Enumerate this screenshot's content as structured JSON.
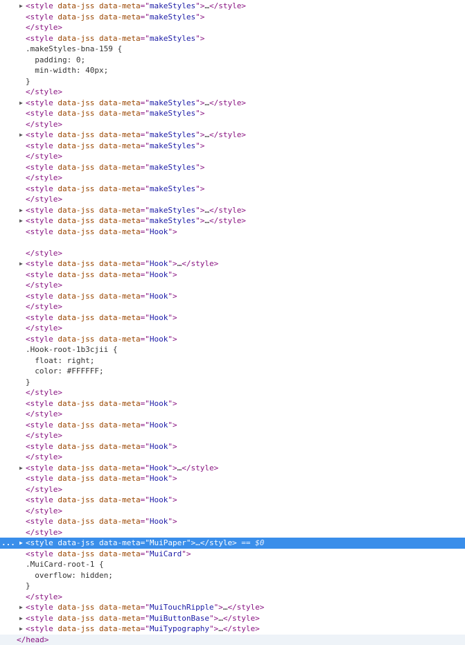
{
  "rows": [
    {
      "type": "collapsed",
      "meta": "makeStyles"
    },
    {
      "type": "open",
      "meta": "makeStyles"
    },
    {
      "type": "close"
    },
    {
      "type": "open",
      "meta": "makeStyles"
    },
    {
      "type": "css",
      "text": ".makeStyles-bna-159 {"
    },
    {
      "type": "css",
      "text": "  padding: 0;"
    },
    {
      "type": "css",
      "text": "  min-width: 40px;"
    },
    {
      "type": "css",
      "text": "}"
    },
    {
      "type": "close"
    },
    {
      "type": "collapsed",
      "meta": "makeStyles"
    },
    {
      "type": "open",
      "meta": "makeStyles"
    },
    {
      "type": "close"
    },
    {
      "type": "collapsed",
      "meta": "makeStyles"
    },
    {
      "type": "open",
      "meta": "makeStyles"
    },
    {
      "type": "close"
    },
    {
      "type": "open",
      "meta": "makeStyles"
    },
    {
      "type": "close"
    },
    {
      "type": "open",
      "meta": "makeStyles"
    },
    {
      "type": "close"
    },
    {
      "type": "collapsed",
      "meta": "makeStyles"
    },
    {
      "type": "collapsed",
      "meta": "makeStyles"
    },
    {
      "type": "open",
      "meta": "Hook"
    },
    {
      "type": "blank"
    },
    {
      "type": "close"
    },
    {
      "type": "collapsed",
      "meta": "Hook"
    },
    {
      "type": "open",
      "meta": "Hook"
    },
    {
      "type": "close"
    },
    {
      "type": "open",
      "meta": "Hook"
    },
    {
      "type": "close"
    },
    {
      "type": "open",
      "meta": "Hook"
    },
    {
      "type": "close"
    },
    {
      "type": "open",
      "meta": "Hook"
    },
    {
      "type": "css",
      "text": ".Hook-root-1b3cjii {"
    },
    {
      "type": "css",
      "text": "  float: right;"
    },
    {
      "type": "css",
      "text": "  color: #FFFFFF;"
    },
    {
      "type": "css",
      "text": "}"
    },
    {
      "type": "close"
    },
    {
      "type": "open",
      "meta": "Hook"
    },
    {
      "type": "close"
    },
    {
      "type": "open",
      "meta": "Hook"
    },
    {
      "type": "close"
    },
    {
      "type": "open",
      "meta": "Hook"
    },
    {
      "type": "close"
    },
    {
      "type": "collapsed",
      "meta": "Hook"
    },
    {
      "type": "open",
      "meta": "Hook"
    },
    {
      "type": "close"
    },
    {
      "type": "open",
      "meta": "Hook"
    },
    {
      "type": "close"
    },
    {
      "type": "open",
      "meta": "Hook"
    },
    {
      "type": "close"
    },
    {
      "type": "collapsed",
      "meta": "MuiPaper",
      "selected": true,
      "suffix": " == $0",
      "dots": "..."
    },
    {
      "type": "open",
      "meta": "MuiCard"
    },
    {
      "type": "css",
      "text": ".MuiCard-root-1 {"
    },
    {
      "type": "css",
      "text": "  overflow: hidden;"
    },
    {
      "type": "css",
      "text": "}"
    },
    {
      "type": "close"
    },
    {
      "type": "collapsed",
      "meta": "MuiTouchRipple"
    },
    {
      "type": "collapsed",
      "meta": "MuiButtonBase"
    },
    {
      "type": "collapsed",
      "meta": "MuiTypography"
    },
    {
      "type": "headclose",
      "text": "</head>"
    }
  ],
  "strings": {
    "open_tag": "<style",
    "attr1": " data-jss",
    "attr2": " data-meta",
    "eq_quote": "=\"",
    "end_quote": "\"",
    "gt": ">",
    "ellipsis": "…",
    "close_tag": "</style>",
    "triangle": "▶"
  }
}
